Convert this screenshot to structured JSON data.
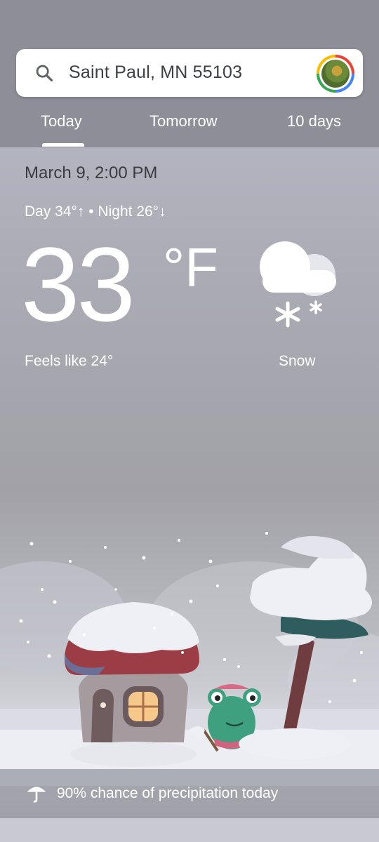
{
  "search": {
    "query": "Saint Paul, MN 55103"
  },
  "tabs": [
    {
      "label": "Today"
    },
    {
      "label": "Tomorrow"
    },
    {
      "label": "10 days"
    }
  ],
  "current": {
    "date": "March 9, 2:00 PM",
    "day_night": "Day 34°↑ • Night 26°↓",
    "temperature": "33",
    "unit": "°F",
    "feels_like": "Feels like 24°",
    "condition": "Snow",
    "condition_icon": "snow-cloud-icon"
  },
  "precipitation": {
    "text": "90% chance of precipitation today",
    "icon": "umbrella-icon"
  },
  "colors": {
    "top_bar": "#8e8e99",
    "text_light": "#ffffff",
    "text_dark": "#3b3b40"
  }
}
